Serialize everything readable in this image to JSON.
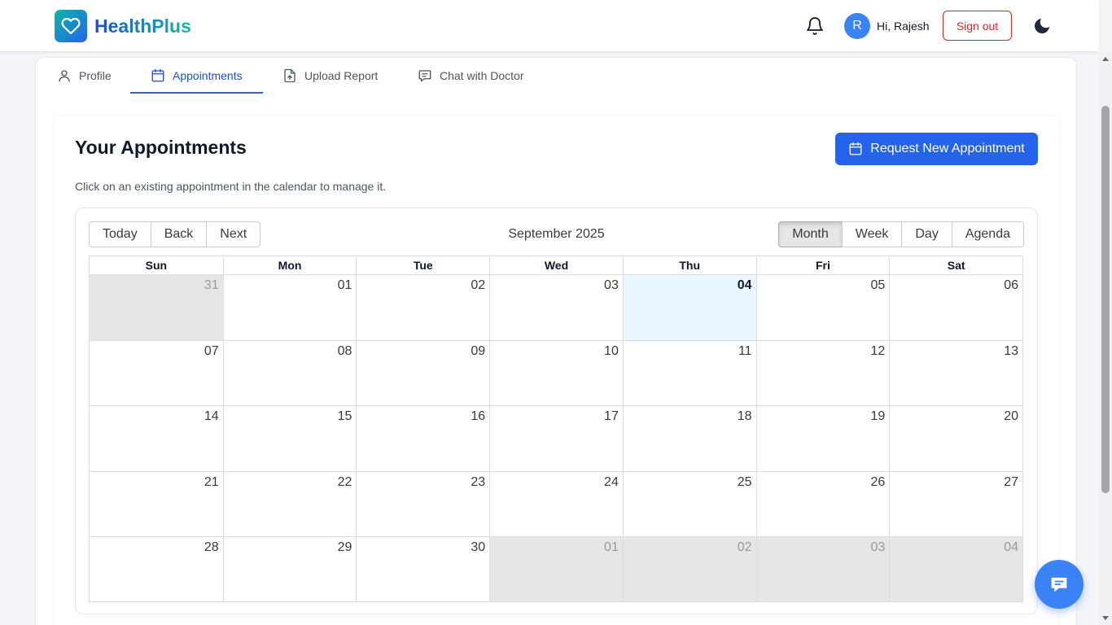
{
  "app": {
    "name": "HealthPlus",
    "brand_start": "#14b8a6",
    "brand_end": "#2563eb"
  },
  "header": {
    "bell_icon": "bell-icon",
    "avatar_letter": "R",
    "greeting": "Hi, Rajesh",
    "signout_label": "Sign out",
    "theme_icon": "moon-icon"
  },
  "tabs": [
    {
      "label": "Profile",
      "icon": "user-icon",
      "active": false
    },
    {
      "label": "Appointments",
      "icon": "calendar-icon",
      "active": true
    },
    {
      "label": "Upload Report",
      "icon": "file-upload-icon",
      "active": false
    },
    {
      "label": "Chat with Doctor",
      "icon": "message-icon",
      "active": false
    }
  ],
  "page": {
    "title": "Your Appointments",
    "subtitle": "Click on an existing appointment in the calendar to manage it.",
    "request_button": "Request New Appointment"
  },
  "calendar": {
    "label": "September 2025",
    "nav_buttons": [
      "Today",
      "Back",
      "Next"
    ],
    "view_buttons": [
      "Month",
      "Week",
      "Day",
      "Agenda"
    ],
    "active_view": "Month",
    "weekdays": [
      "Sun",
      "Mon",
      "Tue",
      "Wed",
      "Thu",
      "Fri",
      "Sat"
    ],
    "days": [
      {
        "d": "31",
        "off": true
      },
      {
        "d": "01"
      },
      {
        "d": "02"
      },
      {
        "d": "03"
      },
      {
        "d": "04",
        "today": true
      },
      {
        "d": "05"
      },
      {
        "d": "06"
      },
      {
        "d": "07"
      },
      {
        "d": "08"
      },
      {
        "d": "09"
      },
      {
        "d": "10"
      },
      {
        "d": "11"
      },
      {
        "d": "12"
      },
      {
        "d": "13"
      },
      {
        "d": "14"
      },
      {
        "d": "15"
      },
      {
        "d": "16"
      },
      {
        "d": "17"
      },
      {
        "d": "18"
      },
      {
        "d": "19"
      },
      {
        "d": "20"
      },
      {
        "d": "21"
      },
      {
        "d": "22"
      },
      {
        "d": "23"
      },
      {
        "d": "24"
      },
      {
        "d": "25"
      },
      {
        "d": "26"
      },
      {
        "d": "27"
      },
      {
        "d": "28"
      },
      {
        "d": "29"
      },
      {
        "d": "30"
      },
      {
        "d": "01",
        "off": true
      },
      {
        "d": "02",
        "off": true
      },
      {
        "d": "03",
        "off": true
      },
      {
        "d": "04",
        "off": true
      }
    ]
  },
  "chat_fab_icon": "chat-bubble-icon"
}
